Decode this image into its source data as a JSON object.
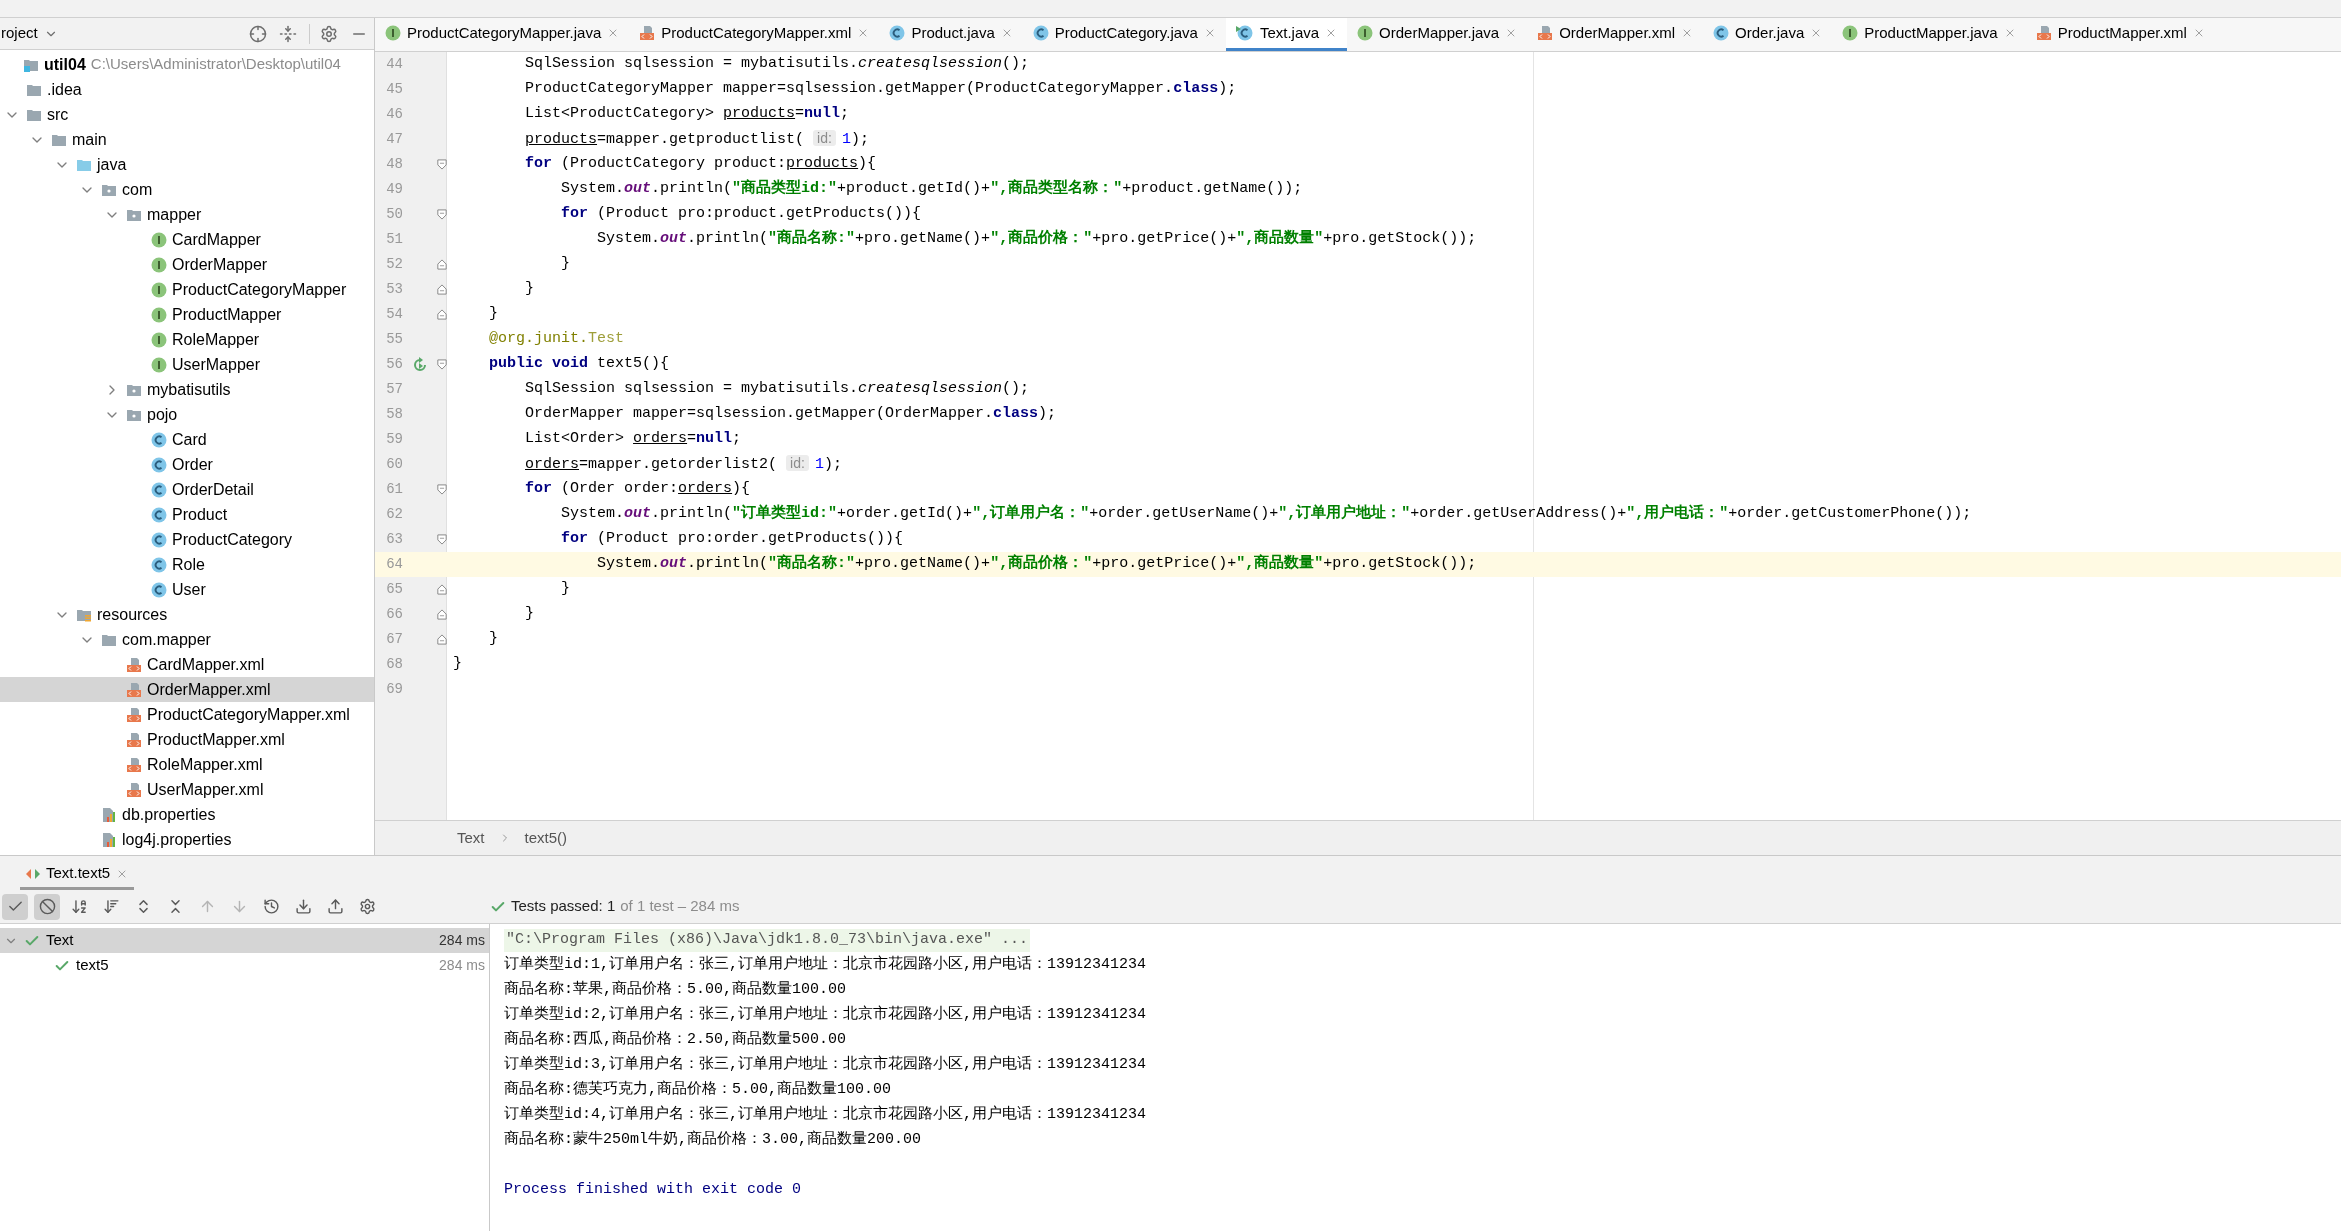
{
  "project_panel": {
    "title": "roject",
    "tree": [
      {
        "label": "util04",
        "path": "C:\\Users\\Administrator\\Desktop\\util04",
        "kind": "module",
        "selected": false,
        "children": [
          {
            "label": ".idea",
            "kind": "folder",
            "selected": false
          },
          {
            "label": "src",
            "kind": "folder",
            "selected": false,
            "expanded": true,
            "children": [
              {
                "label": "main",
                "kind": "folder",
                "selected": false,
                "expanded": true,
                "children": [
                  {
                    "label": "java",
                    "kind": "source",
                    "selected": false,
                    "expanded": true,
                    "children": [
                      {
                        "label": "com",
                        "kind": "package",
                        "selected": false,
                        "expanded": true,
                        "children": [
                          {
                            "label": "mapper",
                            "kind": "package",
                            "selected": false,
                            "expanded": true,
                            "children": [
                              {
                                "label": "CardMapper",
                                "kind": "interface",
                                "selected": false
                              },
                              {
                                "label": "OrderMapper",
                                "kind": "interface",
                                "selected": false
                              },
                              {
                                "label": "ProductCategoryMapper",
                                "kind": "interface",
                                "selected": false
                              },
                              {
                                "label": "ProductMapper",
                                "kind": "interface",
                                "selected": false
                              },
                              {
                                "label": "RoleMapper",
                                "kind": "interface",
                                "selected": false
                              },
                              {
                                "label": "UserMapper",
                                "kind": "interface",
                                "selected": false
                              }
                            ]
                          },
                          {
                            "label": "mybatisutils",
                            "kind": "package",
                            "selected": false,
                            "expanded": false
                          },
                          {
                            "label": "pojo",
                            "kind": "package",
                            "selected": false,
                            "expanded": true,
                            "children": [
                              {
                                "label": "Card",
                                "kind": "class",
                                "selected": false
                              },
                              {
                                "label": "Order",
                                "kind": "class",
                                "selected": false
                              },
                              {
                                "label": "OrderDetail",
                                "kind": "class",
                                "selected": false
                              },
                              {
                                "label": "Product",
                                "kind": "class",
                                "selected": false
                              },
                              {
                                "label": "ProductCategory",
                                "kind": "class",
                                "selected": false
                              },
                              {
                                "label": "Role",
                                "kind": "class",
                                "selected": false
                              },
                              {
                                "label": "User",
                                "kind": "class",
                                "selected": false
                              }
                            ]
                          }
                        ]
                      }
                    ]
                  },
                  {
                    "label": "resources",
                    "kind": "resources",
                    "selected": false,
                    "expanded": true,
                    "children": [
                      {
                        "label": "com.mapper",
                        "kind": "folder",
                        "selected": false,
                        "expanded": true,
                        "children": [
                          {
                            "label": "CardMapper.xml",
                            "kind": "xml",
                            "selected": false
                          },
                          {
                            "label": "OrderMapper.xml",
                            "kind": "xml",
                            "selected": true
                          },
                          {
                            "label": "ProductCategoryMapper.xml",
                            "kind": "xml",
                            "selected": false
                          },
                          {
                            "label": "ProductMapper.xml",
                            "kind": "xml",
                            "selected": false
                          },
                          {
                            "label": "RoleMapper.xml",
                            "kind": "xml",
                            "selected": false
                          },
                          {
                            "label": "UserMapper.xml",
                            "kind": "xml",
                            "selected": false
                          }
                        ]
                      },
                      {
                        "label": "db.properties",
                        "kind": "properties",
                        "selected": false
                      },
                      {
                        "label": "log4j.properties",
                        "kind": "properties",
                        "selected": false
                      }
                    ]
                  }
                ]
              }
            ]
          }
        ]
      }
    ]
  },
  "editor_tabs": [
    {
      "label": "ProductCategoryMapper.java",
      "kind": "interface",
      "selected": false
    },
    {
      "label": "ProductCategoryMapper.xml",
      "kind": "xml",
      "selected": false
    },
    {
      "label": "Product.java",
      "kind": "class",
      "selected": false
    },
    {
      "label": "ProductCategory.java",
      "kind": "class",
      "selected": false
    },
    {
      "label": "Text.java",
      "kind": "test",
      "selected": true
    },
    {
      "label": "OrderMapper.java",
      "kind": "interface",
      "selected": false
    },
    {
      "label": "OrderMapper.xml",
      "kind": "xml",
      "selected": false
    },
    {
      "label": "Order.java",
      "kind": "class",
      "selected": false
    },
    {
      "label": "ProductMapper.java",
      "kind": "interface",
      "selected": false
    },
    {
      "label": "ProductMapper.xml",
      "kind": "xml",
      "selected": false
    }
  ],
  "code_lines": [
    {
      "number": "44",
      "fold_start": false,
      "fold_end": false,
      "run": false,
      "current": false,
      "tokens": [
        {
          "t": "        SqlSession sqlsession = mybatisutils.",
          "kind": "plain"
        },
        {
          "t": "createsqlsession",
          "kind": "italic"
        },
        {
          "t": "();",
          "kind": "plain"
        }
      ]
    },
    {
      "number": "45",
      "fold_start": false,
      "fold_end": false,
      "run": false,
      "current": false,
      "tokens": [
        {
          "t": "        ProductCategoryMapper mapper=sqlsession.getMapper(ProductCategoryMapper.",
          "kind": "plain"
        },
        {
          "t": "class",
          "kind": "keyword"
        },
        {
          "t": ");",
          "kind": "plain"
        }
      ]
    },
    {
      "number": "46",
      "fold_start": false,
      "fold_end": false,
      "run": false,
      "current": false,
      "tokens": [
        {
          "t": "        List<ProductCategory> ",
          "kind": "plain"
        },
        {
          "t": "products",
          "kind": "underline"
        },
        {
          "t": "=",
          "kind": "plain"
        },
        {
          "t": "null",
          "kind": "keyword"
        },
        {
          "t": ";",
          "kind": "plain"
        }
      ]
    },
    {
      "number": "47",
      "fold_start": false,
      "fold_end": false,
      "run": false,
      "current": false,
      "tokens": [
        {
          "t": "        products",
          "kind": "underline"
        },
        {
          "t": "=mapper.getproductlist( ",
          "kind": "plain"
        },
        {
          "t": "id:",
          "kind": "hint"
        },
        {
          "t": "1",
          "kind": "number"
        },
        {
          "t": ");",
          "kind": "plain"
        }
      ]
    },
    {
      "number": "48",
      "fold_start": true,
      "fold_end": false,
      "run": false,
      "current": false,
      "tokens": [
        {
          "t": "        for",
          "kind": "keyword"
        },
        {
          "t": " (ProductCategory product:",
          "kind": "plain"
        },
        {
          "t": "products",
          "kind": "underline"
        },
        {
          "t": "){",
          "kind": "plain"
        }
      ]
    },
    {
      "number": "49",
      "fold_start": false,
      "fold_end": false,
      "run": false,
      "current": false,
      "tokens": [
        {
          "t": "            System.",
          "kind": "plain"
        },
        {
          "t": "out",
          "kind": "field"
        },
        {
          "t": ".println(",
          "kind": "plain"
        },
        {
          "t": "\"商品类型id:\"",
          "kind": "string"
        },
        {
          "t": "+product.getId()+",
          "kind": "plain"
        },
        {
          "t": "\",商品类型名称：\"",
          "kind": "string"
        },
        {
          "t": "+product.getName());",
          "kind": "plain"
        }
      ]
    },
    {
      "number": "50",
      "fold_start": true,
      "fold_end": false,
      "run": false,
      "current": false,
      "tokens": [
        {
          "t": "            for",
          "kind": "keyword"
        },
        {
          "t": " (Product pro:product.getProducts()){",
          "kind": "plain"
        }
      ]
    },
    {
      "number": "51",
      "fold_start": false,
      "fold_end": false,
      "run": false,
      "current": false,
      "tokens": [
        {
          "t": "                System.",
          "kind": "plain"
        },
        {
          "t": "out",
          "kind": "field"
        },
        {
          "t": ".println(",
          "kind": "plain"
        },
        {
          "t": "\"商品名称:\"",
          "kind": "string"
        },
        {
          "t": "+pro.getName()+",
          "kind": "plain"
        },
        {
          "t": "\",商品价格：\"",
          "kind": "string"
        },
        {
          "t": "+pro.getPrice()+",
          "kind": "plain"
        },
        {
          "t": "\",商品数量\"",
          "kind": "string"
        },
        {
          "t": "+pro.getStock());",
          "kind": "plain"
        }
      ]
    },
    {
      "number": "52",
      "fold_start": false,
      "fold_end": true,
      "run": false,
      "current": false,
      "tokens": [
        {
          "t": "            }",
          "kind": "plain"
        }
      ]
    },
    {
      "number": "53",
      "fold_start": false,
      "fold_end": true,
      "run": false,
      "current": false,
      "tokens": [
        {
          "t": "        }",
          "kind": "plain"
        }
      ]
    },
    {
      "number": "54",
      "fold_start": false,
      "fold_end": true,
      "run": false,
      "current": false,
      "tokens": [
        {
          "t": "    }",
          "kind": "plain"
        }
      ]
    },
    {
      "number": "55",
      "fold_start": false,
      "fold_end": false,
      "run": false,
      "current": false,
      "tokens": [
        {
          "t": "    @org.junit.",
          "kind": "annotation"
        },
        {
          "t": "Test",
          "kind": "annotation-name"
        }
      ]
    },
    {
      "number": "56",
      "fold_start": true,
      "fold_end": false,
      "run": true,
      "current": false,
      "tokens": [
        {
          "t": "    public void",
          "kind": "keyword"
        },
        {
          "t": " text5(){",
          "kind": "plain"
        }
      ]
    },
    {
      "number": "57",
      "fold_start": false,
      "fold_end": false,
      "run": false,
      "current": false,
      "tokens": [
        {
          "t": "        SqlSession sqlsession = mybatisutils.",
          "kind": "plain"
        },
        {
          "t": "createsqlsession",
          "kind": "italic"
        },
        {
          "t": "();",
          "kind": "plain"
        }
      ]
    },
    {
      "number": "58",
      "fold_start": false,
      "fold_end": false,
      "run": false,
      "current": false,
      "tokens": [
        {
          "t": "        OrderMapper mapper=sqlsession.getMapper(OrderMapper.",
          "kind": "plain"
        },
        {
          "t": "class",
          "kind": "keyword"
        },
        {
          "t": ");",
          "kind": "plain"
        }
      ]
    },
    {
      "number": "59",
      "fold_start": false,
      "fold_end": false,
      "run": false,
      "current": false,
      "tokens": [
        {
          "t": "        List<Order> ",
          "kind": "plain"
        },
        {
          "t": "orders",
          "kind": "underline"
        },
        {
          "t": "=",
          "kind": "plain"
        },
        {
          "t": "null",
          "kind": "keyword"
        },
        {
          "t": ";",
          "kind": "plain"
        }
      ]
    },
    {
      "number": "60",
      "fold_start": false,
      "fold_end": false,
      "run": false,
      "current": false,
      "tokens": [
        {
          "t": "        orders",
          "kind": "underline"
        },
        {
          "t": "=mapper.getorderlist2( ",
          "kind": "plain"
        },
        {
          "t": "id:",
          "kind": "hint"
        },
        {
          "t": "1",
          "kind": "number"
        },
        {
          "t": ");",
          "kind": "plain"
        }
      ]
    },
    {
      "number": "61",
      "fold_start": true,
      "fold_end": false,
      "run": false,
      "current": false,
      "tokens": [
        {
          "t": "        for",
          "kind": "keyword"
        },
        {
          "t": " (Order order:",
          "kind": "plain"
        },
        {
          "t": "orders",
          "kind": "underline"
        },
        {
          "t": "){",
          "kind": "plain"
        }
      ]
    },
    {
      "number": "62",
      "fold_start": false,
      "fold_end": false,
      "run": false,
      "current": false,
      "tokens": [
        {
          "t": "            System.",
          "kind": "plain"
        },
        {
          "t": "out",
          "kind": "field"
        },
        {
          "t": ".println(",
          "kind": "plain"
        },
        {
          "t": "\"订单类型id:\"",
          "kind": "string"
        },
        {
          "t": "+order.getId()+",
          "kind": "plain"
        },
        {
          "t": "\",订单用户名：\"",
          "kind": "string"
        },
        {
          "t": "+order.getUserName()+",
          "kind": "plain"
        },
        {
          "t": "\",订单用户地址：\"",
          "kind": "string"
        },
        {
          "t": "+order.getUserAddress()+",
          "kind": "plain"
        },
        {
          "t": "\",用户电话：\"",
          "kind": "string"
        },
        {
          "t": "+order.getCustomerPhone());",
          "kind": "plain"
        }
      ]
    },
    {
      "number": "63",
      "fold_start": true,
      "fold_end": false,
      "run": false,
      "current": false,
      "tokens": [
        {
          "t": "            for",
          "kind": "keyword"
        },
        {
          "t": " (Product pro:order.getProducts()){",
          "kind": "plain"
        }
      ]
    },
    {
      "number": "64",
      "fold_start": false,
      "fold_end": false,
      "run": false,
      "current": true,
      "tokens": [
        {
          "t": "                System.",
          "kind": "plain"
        },
        {
          "t": "out",
          "kind": "field"
        },
        {
          "t": ".println(",
          "kind": "plain"
        },
        {
          "t": "\"商品名称:\"",
          "kind": "string"
        },
        {
          "t": "+pro.getName()+",
          "kind": "plain"
        },
        {
          "t": "\",商品价格：\"",
          "kind": "string"
        },
        {
          "t": "+pro.getPrice()+",
          "kind": "plain"
        },
        {
          "t": "\",商品数量\"",
          "kind": "string"
        },
        {
          "t": "+pro.getStock());",
          "kind": "plain"
        }
      ]
    },
    {
      "number": "65",
      "fold_start": false,
      "fold_end": true,
      "run": false,
      "current": false,
      "tokens": [
        {
          "t": "            }",
          "kind": "plain"
        }
      ]
    },
    {
      "number": "66",
      "fold_start": false,
      "fold_end": true,
      "run": false,
      "current": false,
      "tokens": [
        {
          "t": "        }",
          "kind": "plain"
        }
      ]
    },
    {
      "number": "67",
      "fold_start": false,
      "fold_end": true,
      "run": false,
      "current": false,
      "tokens": [
        {
          "t": "    }",
          "kind": "plain"
        }
      ]
    },
    {
      "number": "68",
      "fold_start": false,
      "fold_end": false,
      "run": false,
      "current": false,
      "tokens": [
        {
          "t": "}",
          "kind": "plain"
        }
      ]
    },
    {
      "number": "69",
      "fold_start": false,
      "fold_end": false,
      "run": false,
      "current": false
    }
  ],
  "breadcrumb": [
    "Text",
    "text5()"
  ],
  "run_panel": {
    "tab": "Text.text5",
    "status": "Tests passed: 1",
    "status_detail": "of 1 test – 284 ms",
    "toolbar": [
      {
        "kind": "check",
        "on": true
      },
      {
        "kind": "stop",
        "on": true
      },
      {
        "kind": "sort-alpha",
        "on": false
      },
      {
        "kind": "sort-duration",
        "on": false
      },
      {
        "kind": "expand",
        "on": false
      },
      {
        "kind": "collapse",
        "on": false
      },
      {
        "kind": "up",
        "on": false
      },
      {
        "kind": "down",
        "on": false
      },
      {
        "kind": "history",
        "on": false
      },
      {
        "kind": "import",
        "on": false
      },
      {
        "kind": "export",
        "on": false
      },
      {
        "kind": "settings",
        "on": false
      }
    ],
    "tests": [
      {
        "label": "Text",
        "time": "284 ms",
        "selected": true,
        "expanded": true,
        "children": [
          {
            "label": "text5",
            "time": "284 ms",
            "selected": false
          }
        ]
      }
    ],
    "console": [
      {
        "kind": "command",
        "text": "\"C:\\Program Files (x86)\\Java\\jdk1.8.0_73\\bin\\java.exe\" ..."
      },
      {
        "kind": "output",
        "text": "订单类型id:1,订单用户名：张三,订单用户地址：北京市花园路小区,用户电话：13912341234"
      },
      {
        "kind": "output",
        "text": "商品名称:苹果,商品价格：5.00,商品数量100.00"
      },
      {
        "kind": "output",
        "text": "订单类型id:2,订单用户名：张三,订单用户地址：北京市花园路小区,用户电话：13912341234"
      },
      {
        "kind": "output",
        "text": "商品名称:西瓜,商品价格：2.50,商品数量500.00"
      },
      {
        "kind": "output",
        "text": "订单类型id:3,订单用户名：张三,订单用户地址：北京市花园路小区,用户电话：13912341234"
      },
      {
        "kind": "output",
        "text": "商品名称:德芙巧克力,商品价格：5.00,商品数量100.00"
      },
      {
        "kind": "output",
        "text": "订单类型id:4,订单用户名：张三,订单用户地址：北京市花园路小区,用户电话：13912341234"
      },
      {
        "kind": "output",
        "text": "商品名称:蒙牛250ml牛奶,商品价格：3.00,商品数量200.00"
      },
      {
        "kind": "exit",
        "text": "Process finished with exit code 0"
      }
    ]
  }
}
